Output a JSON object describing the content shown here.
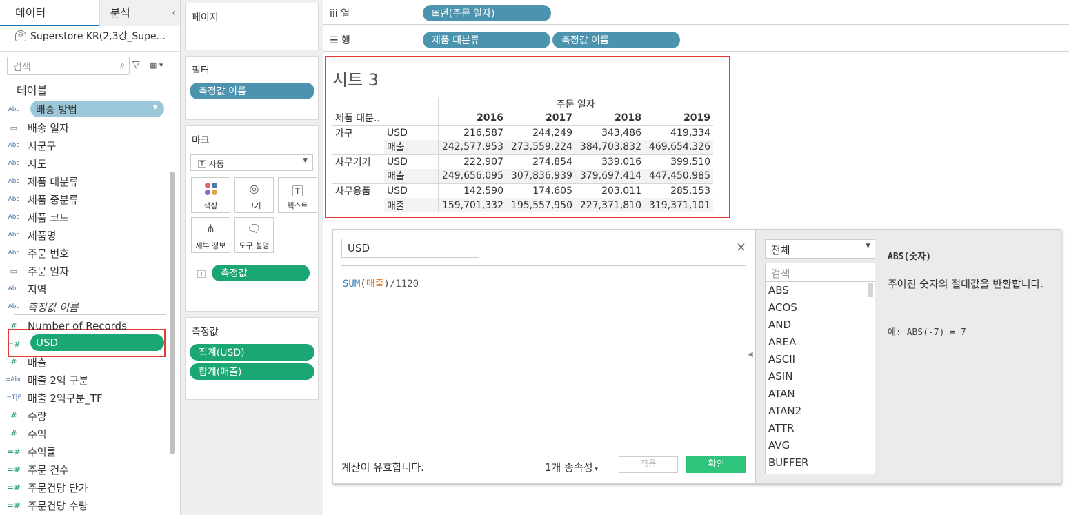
{
  "left_pane": {
    "tab_data": "데이터",
    "tab_analysis": "분석",
    "collapse": "‹",
    "datasource": "Superstore KR(2,3강_Supe...",
    "search_placeholder": "검색",
    "tables_title": "테이블",
    "dimensions": [
      {
        "type": "Abc",
        "name": "배송 방법"
      },
      {
        "type": "date",
        "name": "배송 일자"
      },
      {
        "type": "Abc",
        "name": "시군구"
      },
      {
        "type": "Abc",
        "name": "시도"
      },
      {
        "type": "Abc",
        "name": "제품 대분류"
      },
      {
        "type": "Abc",
        "name": "제품 중분류"
      },
      {
        "type": "Abc",
        "name": "제품 코드"
      },
      {
        "type": "Abc",
        "name": "제품명"
      },
      {
        "type": "Abc",
        "name": "주문 번호"
      },
      {
        "type": "date",
        "name": "주문 일자"
      },
      {
        "type": "Abc",
        "name": "지역"
      },
      {
        "type": "Abc",
        "name": "측정값 이름"
      }
    ],
    "measures": [
      {
        "type": "#",
        "name": "Number of Records"
      },
      {
        "type": "=#",
        "name": "USD"
      },
      {
        "type": "#",
        "name": "매출"
      },
      {
        "type": "=Abc",
        "name": "매출 2억 구분"
      },
      {
        "type": "=T|F",
        "name": "매출 2억구분_TF"
      },
      {
        "type": "#",
        "name": "수량"
      },
      {
        "type": "#",
        "name": "수익"
      },
      {
        "type": "=#",
        "name": "수익률"
      },
      {
        "type": "=#",
        "name": "주문 건수"
      },
      {
        "type": "=#",
        "name": "주문건당 단가"
      },
      {
        "type": "=#",
        "name": "주문건당 수량"
      }
    ]
  },
  "cards": {
    "pages_title": "페이지",
    "filters_title": "필터",
    "filters": [
      "측정값 이름"
    ],
    "marks_title": "마크",
    "marks_type": "자동",
    "marks_buttons": [
      {
        "icon": "color-icon",
        "label": "색상"
      },
      {
        "icon": "size-icon",
        "label": "크기"
      },
      {
        "icon": "text-icon",
        "label": "텍스트"
      },
      {
        "icon": "detail-icon",
        "label": "세부 정보"
      },
      {
        "icon": "tooltip-icon",
        "label": "도구 설명"
      }
    ],
    "marks_pill": "측정값",
    "measure_values_title": "측정값",
    "measure_values": [
      "집계(USD)",
      "합계(매출)"
    ]
  },
  "shelves": {
    "columns_label": "열",
    "columns_pills": [
      "년(주문 일자)"
    ],
    "rows_label": "행",
    "rows_pills": [
      "제품 대분류",
      "측정값 이름"
    ]
  },
  "sheet": {
    "title": "시트 3",
    "col_header": "주문 일자",
    "row_header": "제품 대분..",
    "years": [
      "2016",
      "2017",
      "2018",
      "2019"
    ],
    "rows": [
      {
        "category": "가구",
        "measure": "USD",
        "values": [
          "216,587",
          "244,249",
          "343,486",
          "419,334"
        ]
      },
      {
        "category": "",
        "measure": "매출",
        "values": [
          "242,577,953",
          "273,559,224",
          "384,703,832",
          "469,654,326"
        ]
      },
      {
        "category": "사무기기",
        "measure": "USD",
        "values": [
          "222,907",
          "274,854",
          "339,016",
          "399,510"
        ]
      },
      {
        "category": "",
        "measure": "매출",
        "values": [
          "249,656,095",
          "307,836,939",
          "379,697,414",
          "447,450,985"
        ]
      },
      {
        "category": "사무용품",
        "measure": "USD",
        "values": [
          "142,590",
          "174,605",
          "203,011",
          "285,153"
        ]
      },
      {
        "category": "",
        "measure": "매출",
        "values": [
          "159,701,332",
          "195,557,950",
          "227,371,810",
          "319,371,101"
        ]
      }
    ]
  },
  "calc_editor": {
    "name": "USD",
    "close": "×",
    "formula_fn": "SUM",
    "formula_open": "(",
    "formula_field": "매출",
    "formula_rest": ")/1120",
    "status": "계산이 유효합니다.",
    "dependencies": "1개 종속성",
    "apply_label": "적용",
    "ok_label": "확인",
    "category": "전체",
    "fn_search_placeholder": "검색",
    "functions": [
      "ABS",
      "ACOS",
      "AND",
      "AREA",
      "ASCII",
      "ASIN",
      "ATAN",
      "ATAN2",
      "ATTR",
      "AVG",
      "BUFFER"
    ],
    "help_title": "ABS(숫자)",
    "help_desc": "주어진 숫자의 절대값을 반환합니다.",
    "help_example": "예: ABS(-7) = 7"
  }
}
